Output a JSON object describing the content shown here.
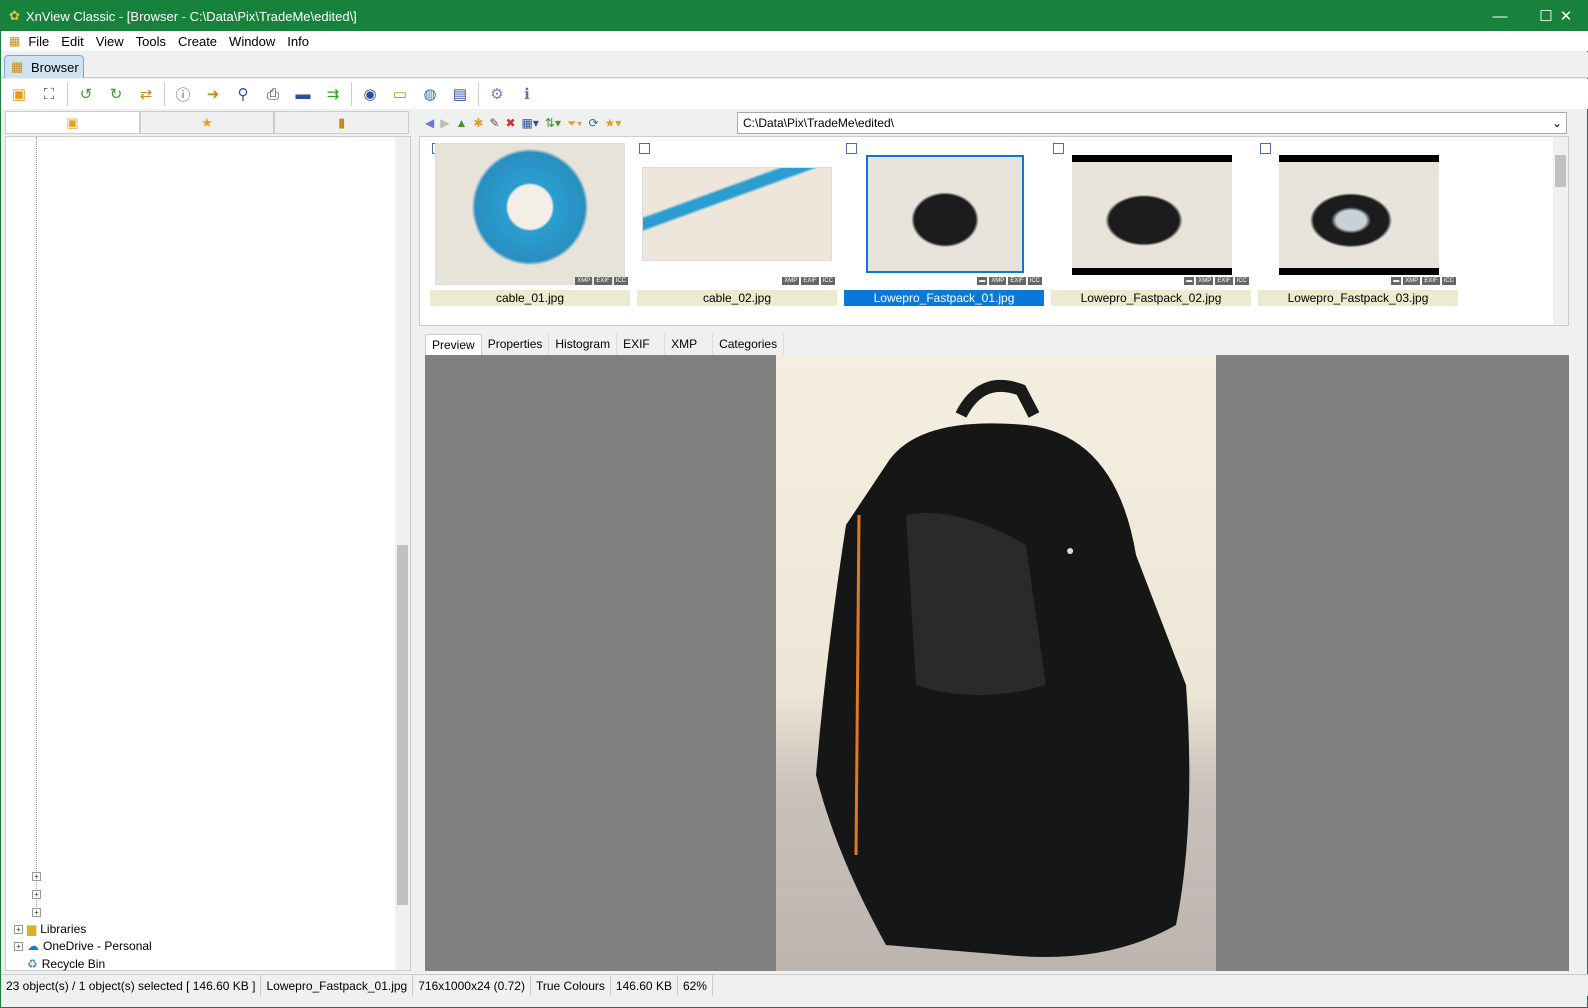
{
  "window": {
    "title": "XnView Classic - [Browser - C:\\Data\\Pix\\TradeMe\\edited\\]",
    "minimize": "—",
    "maximize": "☐",
    "close": "✕"
  },
  "menu": [
    "File",
    "Edit",
    "View",
    "Tools",
    "Create",
    "Window",
    "Info"
  ],
  "tab": {
    "label": "Browser"
  },
  "nav": {
    "path": "C:\\Data\\Pix\\TradeMe\\edited\\"
  },
  "tree": {
    "items": [
      "Libraries",
      "OneDrive - Personal",
      "Recycle Bin"
    ]
  },
  "thumbnails": [
    {
      "name": "cable_01.jpg",
      "selected": false
    },
    {
      "name": "cable_02.jpg",
      "selected": false
    },
    {
      "name": "Lowepro_Fastpack_01.jpg",
      "selected": true
    },
    {
      "name": "Lowepro_Fastpack_02.jpg",
      "selected": false
    },
    {
      "name": "Lowepro_Fastpack_03.jpg",
      "selected": false
    }
  ],
  "badges": [
    "XMP",
    "EXIF",
    "ICC"
  ],
  "preview_tabs": [
    "Preview",
    "Properties",
    "Histogram",
    "EXIF",
    "XMP",
    "Categories"
  ],
  "status": {
    "objects": "23 object(s) / 1 object(s) selected  [ 146.60 KB ]",
    "file": "Lowepro_Fastpack_01.jpg",
    "dims": "716x1000x24 (0.72)",
    "colours": "True Colours",
    "size": "146.60 KB",
    "zoom": "62%"
  },
  "colors": {
    "title_bar": "#17823b",
    "selection": "#0a78d7"
  }
}
